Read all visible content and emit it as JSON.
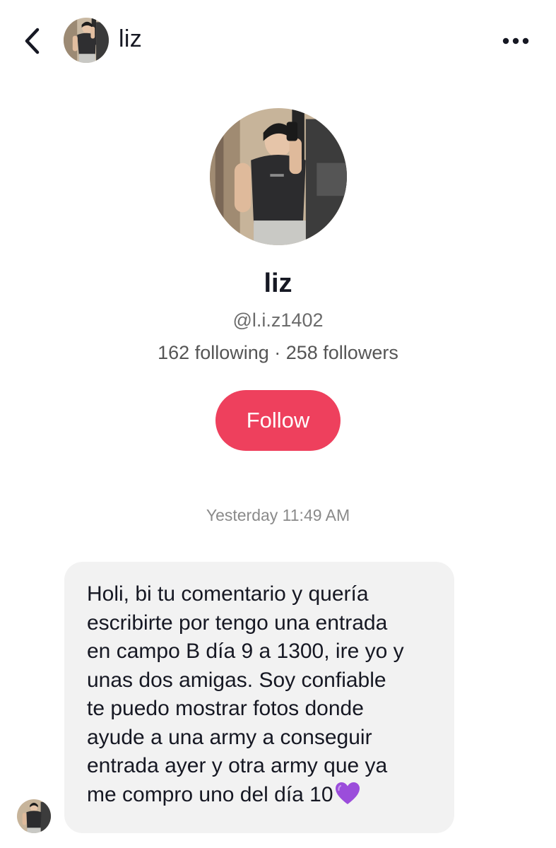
{
  "header": {
    "name": "liz",
    "back_icon": "chevron-left-icon",
    "more_icon": "more-horizontal-icon"
  },
  "profile": {
    "name": "liz",
    "handle": "@l.i.z1402",
    "stats": "162 following · 258 followers",
    "follow_label": "Follow",
    "follow_color": "#ee405d"
  },
  "chat": {
    "timestamp": "Yesterday 11:49 AM",
    "message": "Holi, bi tu comentario y quería\nescribirte por tengo una entrada\nen campo B día 9 a 1300, ire yo y\nunas dos amigas. Soy confiable\nte puedo mostrar fotos donde\nayude a una army a conseguir\nentrada ayer y otra army que ya\nme compro uno del día 10",
    "emoji": "purple-heart-emoji"
  }
}
